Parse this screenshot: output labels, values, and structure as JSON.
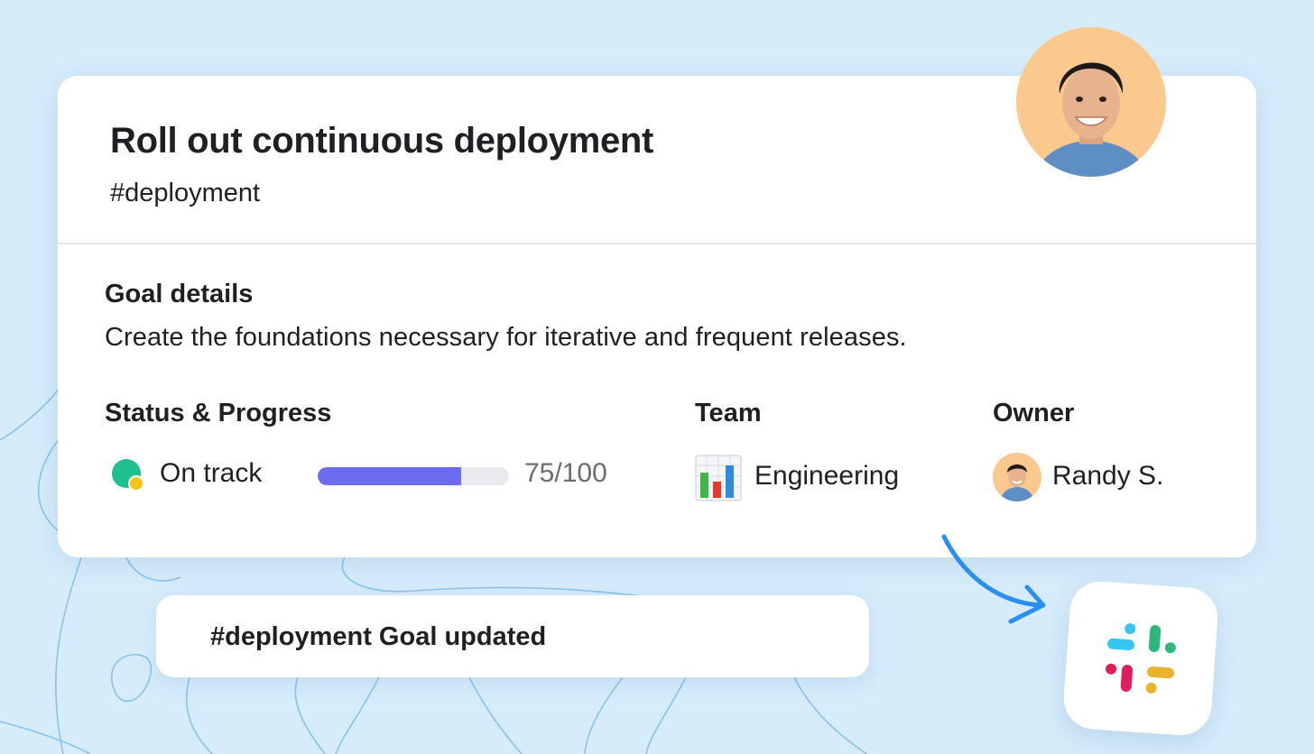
{
  "goal": {
    "title": "Roll out continuous deployment",
    "tag": "#deployment"
  },
  "details": {
    "label": "Goal details",
    "text": "Create the foundations necessary for iterative and frequent releases."
  },
  "status": {
    "label": "Status & Progress",
    "state": "On track",
    "progress_text": "75/100",
    "progress_value": 75,
    "progress_max": 100,
    "progress_color": "#6b6cf0",
    "status_color": "#1fbf8f",
    "status_dot_color": "#f5c518"
  },
  "team": {
    "label": "Team",
    "name": "Engineering",
    "icon": "bar-chart-icon"
  },
  "owner": {
    "label": "Owner",
    "name": "Randy S."
  },
  "notification": {
    "text": "#deployment Goal updated"
  },
  "colors": {
    "background": "#d6ecfb",
    "arrow": "#2a8ef5"
  },
  "integration": {
    "icon": "slack-icon"
  }
}
